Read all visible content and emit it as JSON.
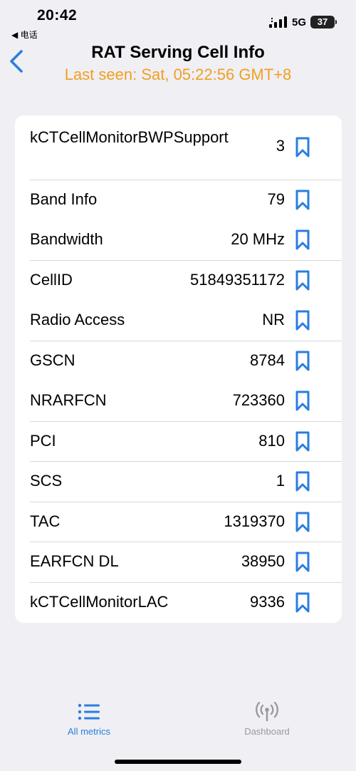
{
  "status_bar": {
    "time": "20:42",
    "back_app": "◀ 电话",
    "network": "5G",
    "battery": "37"
  },
  "header": {
    "title": "RAT Serving Cell Info",
    "subtitle": "Last seen: Sat, 05:22:56 GMT+8"
  },
  "rows": [
    {
      "label": "kCTCellMonitorBWPSupport",
      "value": "3"
    },
    {
      "label": "Band Info",
      "value": "79"
    },
    {
      "label": "Bandwidth",
      "value": "20 MHz"
    },
    {
      "label": "CellID",
      "value": "51849351172"
    },
    {
      "label": "Radio Access",
      "value": "NR"
    },
    {
      "label": "GSCN",
      "value": "8784"
    },
    {
      "label": "NRARFCN",
      "value": "723360"
    },
    {
      "label": "PCI",
      "value": "810"
    },
    {
      "label": "SCS",
      "value": "1"
    },
    {
      "label": "TAC",
      "value": "1319370"
    },
    {
      "label": "EARFCN DL",
      "value": "38950"
    },
    {
      "label": "kCTCellMonitorLAC",
      "value": "9336"
    }
  ],
  "tabs": [
    {
      "label": "All metrics",
      "icon": "list-icon"
    },
    {
      "label": "Dashboard",
      "icon": "antenna-icon"
    }
  ],
  "colors": {
    "accent": "#2a7de0",
    "subtitle": "#f0a020",
    "background": "#efeff4"
  }
}
